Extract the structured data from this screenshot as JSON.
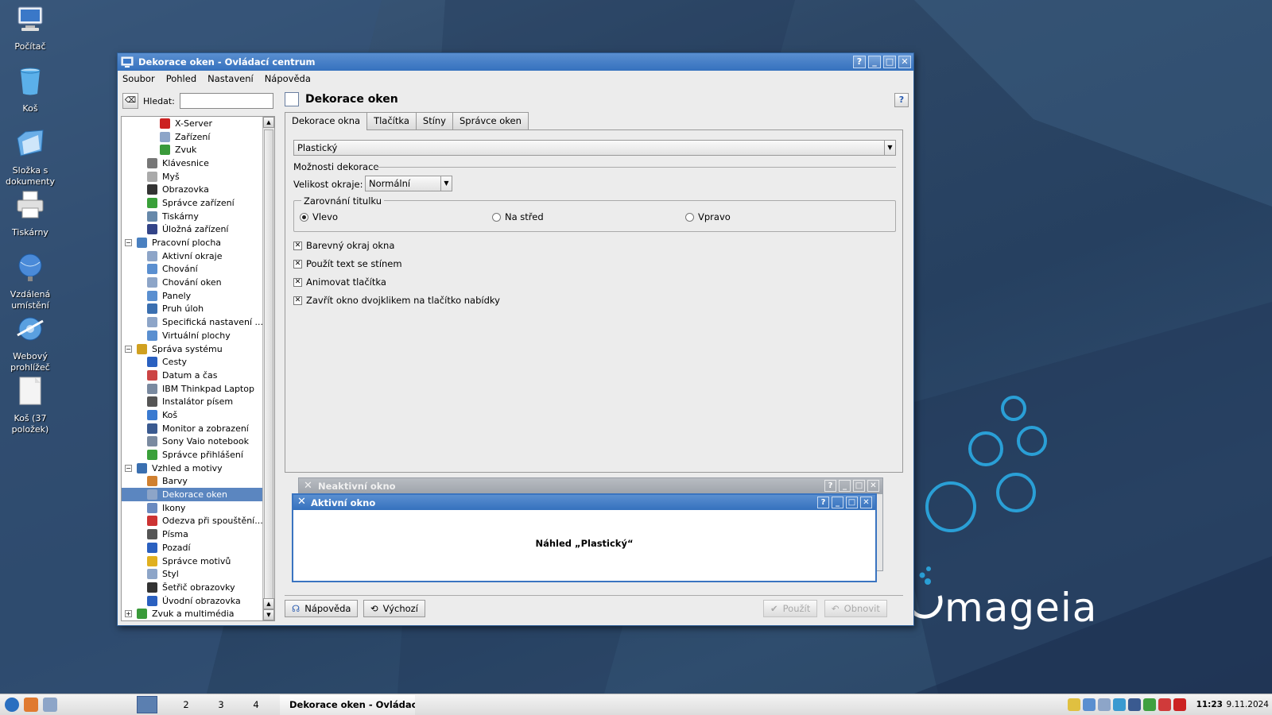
{
  "desktop": {
    "icons": [
      {
        "label": "Počítač",
        "icon": "computer-icon"
      },
      {
        "label": "Koš",
        "icon": "trash-icon"
      },
      {
        "label": "Složka s dokumenty",
        "icon": "documents-folder-icon"
      },
      {
        "label": "Tiskárny",
        "icon": "printer-icon"
      },
      {
        "label": "Vzdálená umístění",
        "icon": "remote-places-icon"
      },
      {
        "label": "Webový prohlížeč",
        "icon": "web-browser-icon"
      },
      {
        "label": "Koš (37 položek)",
        "icon": "trash-full-icon"
      }
    ],
    "logo_text": "mageia",
    "colors": {
      "accent": "#2a9fd6",
      "background": "#2d4766"
    }
  },
  "window": {
    "title": "Dekorace oken - Ovládací centrum",
    "title_buttons": [
      "?",
      "_",
      "□",
      "✕"
    ],
    "menu": [
      "Soubor",
      "Pohled",
      "Nastavení",
      "Nápověda"
    ],
    "search": {
      "label": "Hledat:",
      "value": "",
      "clear_icon": "clear-search-icon"
    },
    "tree": [
      {
        "label": "X-Server",
        "level": 2,
        "color": "#cc2222"
      },
      {
        "label": "Zařízení",
        "level": 2,
        "color": "#8da5c8"
      },
      {
        "label": "Zvuk",
        "level": 2,
        "color": "#3a9a3a"
      },
      {
        "label": "Klávesnice",
        "level": 1,
        "color": "#777777"
      },
      {
        "label": "Myš",
        "level": 1,
        "color": "#aaaaaa"
      },
      {
        "label": "Obrazovka",
        "level": 1,
        "color": "#333333"
      },
      {
        "label": "Správce zařízení",
        "level": 1,
        "color": "#3aa03a"
      },
      {
        "label": "Tiskárny",
        "level": 1,
        "color": "#6688aa"
      },
      {
        "label": "Úložná zařízení",
        "level": 1,
        "color": "#334488"
      },
      {
        "label": "Pracovní plocha",
        "level": 0,
        "expander": "⊖",
        "color": "#4a80c0"
      },
      {
        "label": "Aktivní okraje",
        "level": 1,
        "color": "#8da5c8"
      },
      {
        "label": "Chování",
        "level": 1,
        "color": "#5a8fd0"
      },
      {
        "label": "Chování oken",
        "level": 1,
        "color": "#8da5c8"
      },
      {
        "label": "Panely",
        "level": 1,
        "color": "#5a8fd0"
      },
      {
        "label": "Pruh úloh",
        "level": 1,
        "color": "#3a6fb0"
      },
      {
        "label": "Specifická nastavení ...",
        "level": 1,
        "color": "#8da5c8"
      },
      {
        "label": "Virtuální plochy",
        "level": 1,
        "color": "#5a8fd0"
      },
      {
        "label": "Správa systému",
        "level": 0,
        "expander": "⊖",
        "color": "#d0a020"
      },
      {
        "label": "Cesty",
        "level": 1,
        "color": "#2a60c0"
      },
      {
        "label": "Datum a čas",
        "level": 1,
        "color": "#cc4444"
      },
      {
        "label": "IBM Thinkpad Laptop",
        "level": 1,
        "color": "#7a8aa0"
      },
      {
        "label": "Instalátor písem",
        "level": 1,
        "color": "#555555"
      },
      {
        "label": "Koš",
        "level": 1,
        "color": "#3a7ad0"
      },
      {
        "label": "Monitor a zobrazení",
        "level": 1,
        "color": "#3a5a90"
      },
      {
        "label": "Sony Vaio notebook",
        "level": 1,
        "color": "#7a8aa0"
      },
      {
        "label": "Správce přihlášení",
        "level": 1,
        "color": "#3aa03a"
      },
      {
        "label": "Vzhled a motivy",
        "level": 0,
        "expander": "⊖",
        "color": "#3a6fb0"
      },
      {
        "label": "Barvy",
        "level": 1,
        "color": "#d08030"
      },
      {
        "label": "Dekorace oken",
        "level": 1,
        "color": "#8da5c8",
        "selected": true
      },
      {
        "label": "Ikony",
        "level": 1,
        "color": "#6a8ac0"
      },
      {
        "label": "Odezva při spouštění...",
        "level": 1,
        "color": "#cc3333"
      },
      {
        "label": "Písma",
        "level": 1,
        "color": "#555555"
      },
      {
        "label": "Pozadí",
        "level": 1,
        "color": "#2a60c0"
      },
      {
        "label": "Správce motivů",
        "level": 1,
        "color": "#e0b020"
      },
      {
        "label": "Styl",
        "level": 1,
        "color": "#8da5c8"
      },
      {
        "label": "Šetřič obrazovky",
        "level": 1,
        "color": "#333333"
      },
      {
        "label": "Úvodní obrazovka",
        "level": 1,
        "color": "#2a60c0"
      },
      {
        "label": "Zvuk a multimédia",
        "level": 0,
        "expander": "⊕",
        "color": "#3a9a3a"
      }
    ],
    "page_title": "Dekorace oken",
    "help_corner": "?",
    "tabs": [
      "Dekorace okna",
      "Tlačítka",
      "Stíny",
      "Správce oken"
    ],
    "active_tab": 0,
    "decoration_style": "Plastický",
    "options_title": "Možnosti dekorace",
    "border_size_label": "Velikost okraje:",
    "border_size_value": "Normální",
    "alignment_title": "Zarovnání titulku",
    "alignment_options": [
      "Vlevo",
      "Na střed",
      "Vpravo"
    ],
    "alignment_selected": 0,
    "checkboxes": [
      {
        "label": "Barevný okraj okna",
        "checked": true
      },
      {
        "label": "Použít text se stínem",
        "checked": true
      },
      {
        "label": "Animovat tlačítka",
        "checked": true
      },
      {
        "label": "Zavřít okno dvojklikem na tlačítko nabídky",
        "checked": true
      }
    ],
    "preview": {
      "inactive_title": "Neaktivní okno",
      "active_title": "Aktivní okno",
      "caption": "Náhled „Plastický“"
    },
    "buttons": {
      "help": "Nápověda",
      "defaults": "Výchozí",
      "apply": "Použít",
      "reset": "Obnovit"
    }
  },
  "taskbar": {
    "desktops": [
      "2",
      "3",
      "4"
    ],
    "active_task": "Dekorace oken - Ovládací",
    "clock_time": "11:23",
    "clock_date": "9.11.2024",
    "tray_colors": [
      "#e0c040",
      "#5a8fd0",
      "#8da5c8",
      "#3a9ad0",
      "#3a5a90",
      "#40a040",
      "#d03a3a",
      "#cc2222"
    ]
  }
}
